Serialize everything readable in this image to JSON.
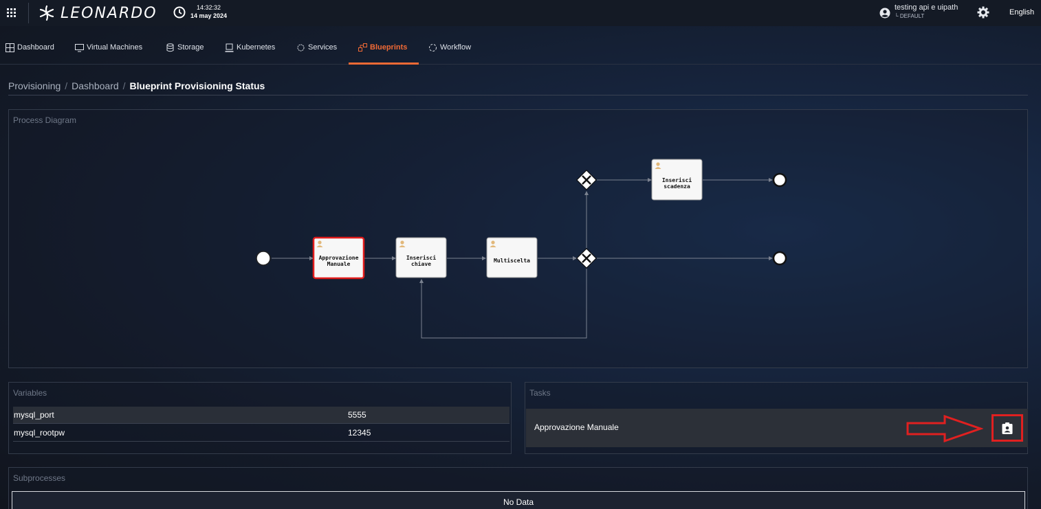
{
  "header": {
    "logo_text": "LEONARDO",
    "time": "14:32:32",
    "date": "14 may 2024",
    "user_name": "testing api e uipath",
    "user_tenant": "DEFAULT",
    "language": "English"
  },
  "nav": {
    "items": [
      {
        "label": "Dashboard",
        "icon": "dashboard-icon"
      },
      {
        "label": "Virtual Machines",
        "icon": "monitor-icon"
      },
      {
        "label": "Storage",
        "icon": "database-icon"
      },
      {
        "label": "Kubernetes",
        "icon": "kubernetes-icon"
      },
      {
        "label": "Services",
        "icon": "services-icon"
      },
      {
        "label": "Blueprints",
        "icon": "blueprints-icon"
      },
      {
        "label": "Workflow",
        "icon": "workflow-icon"
      }
    ],
    "active": "Blueprints",
    "accent_color": "#f26a35"
  },
  "breadcrumb": {
    "items": [
      "Provisioning",
      "Dashboard"
    ],
    "current": "Blueprint Provisioning Status"
  },
  "process_diagram": {
    "title": "Process Diagram",
    "tasks": [
      {
        "label_line1": "Approvazione",
        "label_line2": "Manuale",
        "highlighted": true
      },
      {
        "label_line1": "Inserisci",
        "label_line2": "chiave",
        "highlighted": false
      },
      {
        "label_line1": "Multiscelta",
        "label_line2": "",
        "highlighted": false
      },
      {
        "label_line1": "Inserisci",
        "label_line2": "scadenza",
        "highlighted": false
      }
    ]
  },
  "variables": {
    "title": "Variables",
    "rows": [
      {
        "name": "mysql_port",
        "value": "5555"
      },
      {
        "name": "mysql_rootpw",
        "value": "12345"
      }
    ]
  },
  "tasks": {
    "title": "Tasks",
    "rows": [
      {
        "name": "Approvazione Manuale",
        "action_icon": "assignment-ind-icon"
      }
    ]
  },
  "subprocesses": {
    "title": "Subprocesses",
    "empty_text": "No Data"
  }
}
